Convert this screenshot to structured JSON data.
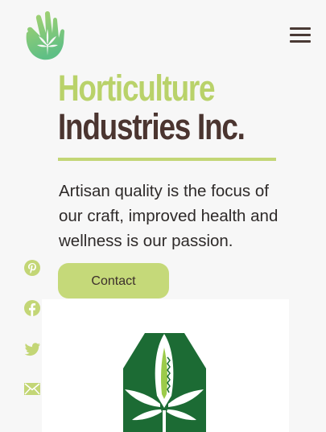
{
  "header": {
    "logo_icon": "hand-leaf-logo",
    "menu_icon": "hamburger-menu-icon"
  },
  "hero": {
    "title_line1": "Horticulture",
    "title_line2": "Industries Inc.",
    "tagline": "Artisan quality is the focus of our craft, improved health and wellness is our passion.",
    "contact_label": "Contact"
  },
  "social": {
    "icons": [
      "pinterest-icon",
      "facebook-icon",
      "twitter-icon",
      "email-icon"
    ]
  },
  "colors": {
    "accent_green": "#b9d26a",
    "button_green": "#c5d979",
    "brand_brown": "#4b3530",
    "emblem_green": "#1c6b34",
    "emblem_light": "#9ccb4a"
  }
}
